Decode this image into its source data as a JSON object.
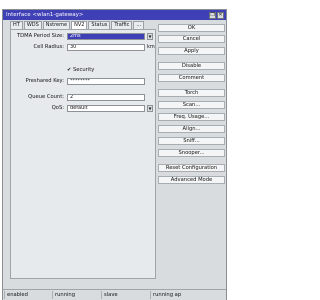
{
  "window": {
    "title": "Interface <wlan1-gateway>",
    "restore_glyph": "❐",
    "close_glyph": "✕"
  },
  "tabs": [
    {
      "label": "HT",
      "active": false
    },
    {
      "label": "WDS",
      "active": false
    },
    {
      "label": "Nstreme",
      "active": false
    },
    {
      "label": "NV2",
      "active": true
    },
    {
      "label": "Status",
      "active": false
    },
    {
      "label": "Traffic",
      "active": false
    },
    {
      "label": "...",
      "active": false
    }
  ],
  "form": {
    "tdma_label": "TDMA Period Size:",
    "tdma_value": "2ms",
    "cell_radius_label": "Cell Radius:",
    "cell_radius_value": "30",
    "cell_radius_unit": "km",
    "security_label": "Security",
    "security_checked": true,
    "check_glyph": "✔",
    "preshared_label": "Preshared Key:",
    "preshared_value": "********",
    "queue_count_label": "Queue Count:",
    "queue_count_value": "2",
    "qos_label": "QoS:",
    "qos_value": "default",
    "dropdown_glyph": "▼"
  },
  "buttons": [
    "OK",
    "Cancel",
    "Apply",
    "Disable",
    "Comment",
    "Torch",
    "Scan...",
    "Freq. Usage...",
    "Align...",
    "Sniff...",
    "Snooper...",
    "Reset Configuration",
    "Advanced Mode"
  ],
  "status": {
    "cells": [
      "enabled",
      "running",
      "slave",
      "running ap"
    ]
  }
}
